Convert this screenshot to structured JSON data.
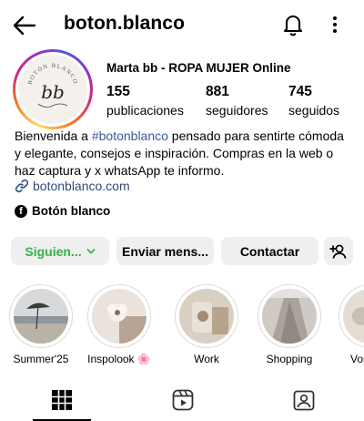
{
  "header": {
    "username": "boton.blanco",
    "icons": [
      "back-arrow-icon",
      "bell-icon",
      "more-vertical-icon"
    ]
  },
  "profile": {
    "avatar_text": "BOTÓN BLANCO",
    "avatar_monogram": "bb",
    "display_name": "Marta bb - ROPA MUJER Online",
    "stats": [
      {
        "value": "155",
        "label": "publicaciones"
      },
      {
        "value": "881",
        "label": "seguidores"
      },
      {
        "value": "745",
        "label": "seguidos"
      }
    ],
    "bio": {
      "line1_pre": "Bienvenida a ",
      "hashtag": "#botonblanco",
      "line1_post": " pensado para sentirte cómoda",
      "line2": "y elegante, consejos e inspiración. Compras en la web o",
      "line3": "haz captura y x whatsApp te informo."
    },
    "link": "botonblanco.com",
    "facebook": "Botón blanco"
  },
  "actions": {
    "following": "Siguien...",
    "message": "Enviar mens...",
    "contact": "Contactar"
  },
  "highlights": [
    {
      "label": "Summer'25"
    },
    {
      "label": "Inspolook 🌸"
    },
    {
      "label": "Work"
    },
    {
      "label": "Shopping"
    },
    {
      "label": "Vos"
    }
  ],
  "tabs": [
    "grid-icon",
    "reels-icon",
    "tagged-icon"
  ],
  "colors": {
    "following_green": "#35b04a",
    "button_bg": "#efefef",
    "hashtag_blue": "#3c5a99",
    "link_blue": "#2f4a7a"
  }
}
